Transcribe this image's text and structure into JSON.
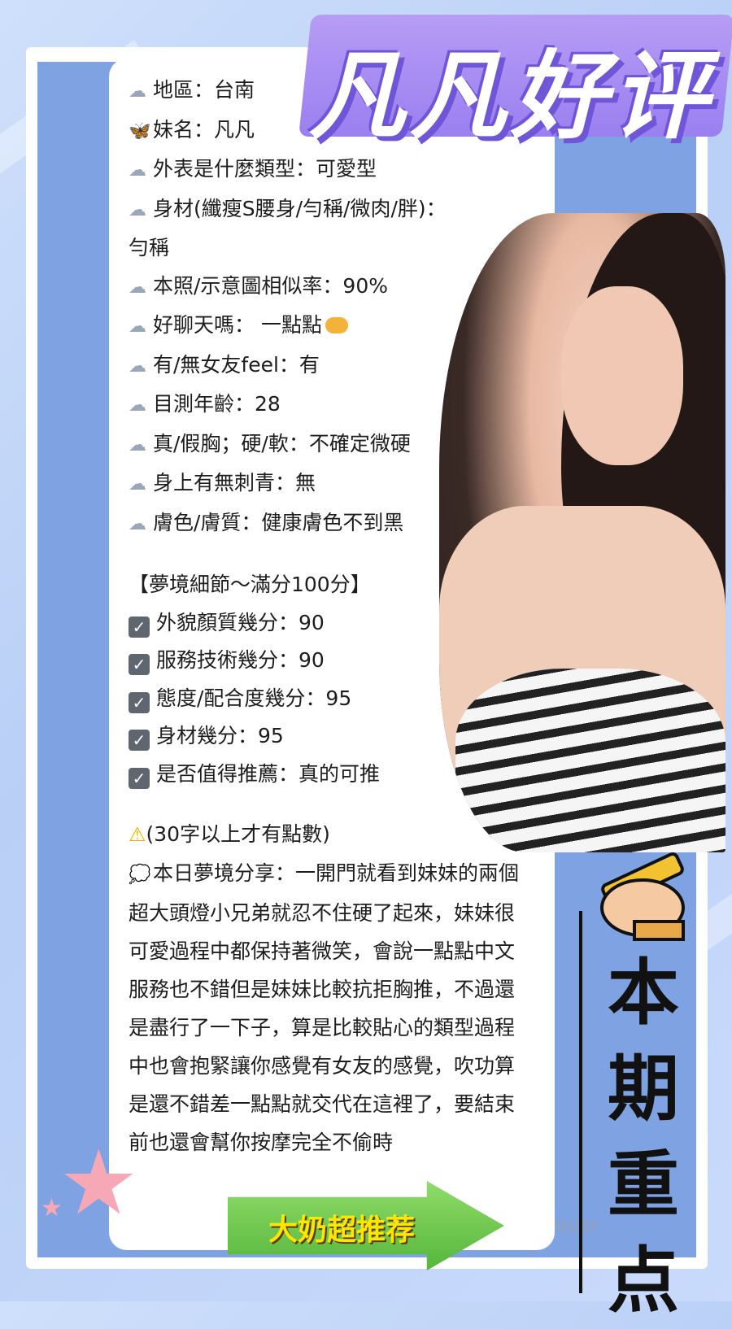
{
  "title": "凡凡好评",
  "profile_lines": [
    "地區：台南",
    "妹名：凡凡",
    "外表是什麼類型：可愛型",
    "身材(纖瘦S腰身/勻稱/微肉/胖)：",
    "勻稱",
    "本照/示意圖相似率：90%",
    "好聊天嗎： 一點點",
    "有/無女友feel：有",
    "目測年齡：28",
    "真/假胸；硬/軟：不確定微硬",
    "身上有無刺青：無",
    "膚色/膚質：健康膚色不到黑"
  ],
  "scores_header": "【夢境細節～滿分100分】",
  "scores": [
    "外貌顏質幾分：90",
    "服務技術幾分：90",
    "態度/配合度幾分：95",
    "身材幾分：95",
    "是否值得推薦：真的可推"
  ],
  "note": "(30字以上才有點數)",
  "share": "本日夢境分享：一開門就看到妹妹的兩個超大頭燈小兄弟就忍不住硬了起來，妹妹很可愛過程中都保持著微笑，會說一點點中文服務也不錯但是妹妹比較抗拒胸推，不過還是盡行了一下子，算是比較貼心的類型過程中也會抱緊讓你感覺有女友的感覺，吹功算是還不錯差一點點就交代在這裡了，要結束前也還會幫你按摩完全不偷時",
  "badge": "大奶超推荐",
  "sticker": [
    "本",
    "期",
    "重",
    "点"
  ],
  "timestamp": "01/07",
  "icons": {
    "cloud": "☁",
    "butterfly": "🦋",
    "check": "✓",
    "warning": "⚠",
    "speech": "💭"
  }
}
